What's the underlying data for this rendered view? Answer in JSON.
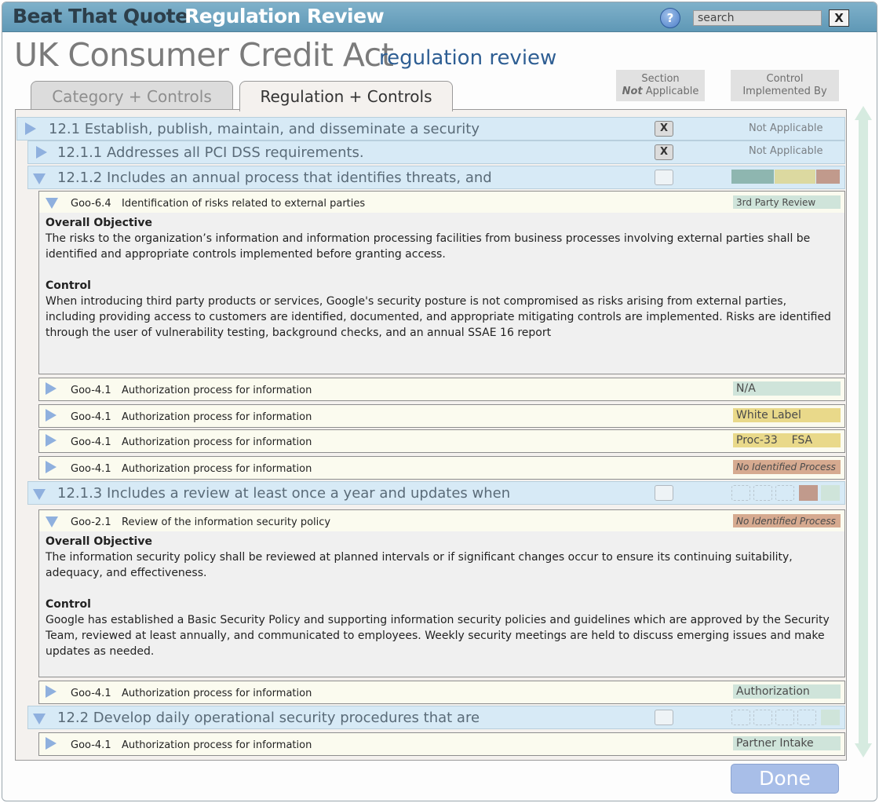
{
  "window": {
    "app_name": "Beat That Quote",
    "screen_name": "Regulation Review",
    "search_placeholder": "search",
    "close_label": "X",
    "help_label": "?"
  },
  "header": {
    "title": "UK Consumer Credit Act",
    "subtitle": "regulation review"
  },
  "tabs": [
    {
      "label": "Category + Controls",
      "active": false
    },
    {
      "label": "Regulation + Controls",
      "active": true
    }
  ],
  "columns": {
    "section_line1": "Section",
    "section_line2_italic": "Not",
    "section_line2_rest": " Applicable",
    "control_line1": "Control",
    "control_line2": "Implemented By"
  },
  "sections": [
    {
      "label": "12.1 Establish, publish, maintain, and disseminate a security",
      "checked": "X",
      "status": "Not Applicable"
    },
    {
      "label": "12.1.1 Addresses all PCI DSS requirements.",
      "checked": "X",
      "status": "Not Applicable"
    },
    {
      "label": "12.1.2 Includes an annual process that identifies threats, and",
      "checked": "",
      "status": ""
    },
    {
      "label": "12.1.3 Includes a review at least once a year and updates when",
      "checked": "",
      "status": ""
    },
    {
      "label": "12.2 Develop daily operational security procedures that are",
      "checked": "",
      "status": ""
    }
  ],
  "swatch_colors": {
    "teal": "#8eb6b0",
    "yellow": "#dcd9a0",
    "brown": "#c19a8c",
    "mint": "#cfe4da"
  },
  "details": [
    {
      "code": "Goo-6.4",
      "title": "Identification of risks related to external parties",
      "tag": "3rd Party Review",
      "objective_label": "Overall Objective",
      "objective_text": "The risks to the organization’s information and information processing facilities from business processes involving external parties shall be identified and appropriate controls implemented before granting access.",
      "control_label": "Control",
      "control_text": "When introducing third party products or services, Google's security posture is not compromised as risks arising from external parties, including providing access to customers are identified, documented, and appropriate mitigating controls are implemented. Risks are identified through the user of vulnerability testing, background checks, and an annual SSAE 16 report"
    },
    {
      "code": "Goo-2.1",
      "title": "Review of the information security policy",
      "tag": "No Identified Process",
      "objective_label": "Overall Objective",
      "objective_text": "The information security policy shall be reviewed at planned intervals or if significant changes occur to ensure its continuing suitability, adequacy, and effectiveness.",
      "control_label": "Control",
      "control_text": "Google has established a Basic Security Policy and supporting information security policies and guidelines which are approved by the Security Team, reviewed at least annually, and communicated to employees. Weekly security meetings are held to discuss emerging issues and make updates as needed."
    }
  ],
  "controls": [
    {
      "code": "Goo-4.1",
      "title": "Authorization process for information",
      "tag": "N/A",
      "tag_color": "#cfe4da"
    },
    {
      "code": "Goo-4.1",
      "title": "Authorization process for information",
      "tag": "White Label",
      "tag_color": "#e9d98a"
    },
    {
      "code": "Goo-4.1",
      "title": "Authorization process for information",
      "tag": "Proc-33    FSA",
      "tag_color": "#e9d98a"
    },
    {
      "code": "Goo-4.1",
      "title": "Authorization process for information",
      "tag": "No Identified Process",
      "tag_color": "#d6aa90"
    },
    {
      "code": "Goo-4.1",
      "title": "Authorization process for information",
      "tag": "Authorization",
      "tag_color": "#cfe4da"
    },
    {
      "code": "Goo-4.1",
      "title": "Authorization process for information",
      "tag": "Partner Intake",
      "tag_color": "#cfe4da"
    }
  ],
  "done_label": "Done"
}
